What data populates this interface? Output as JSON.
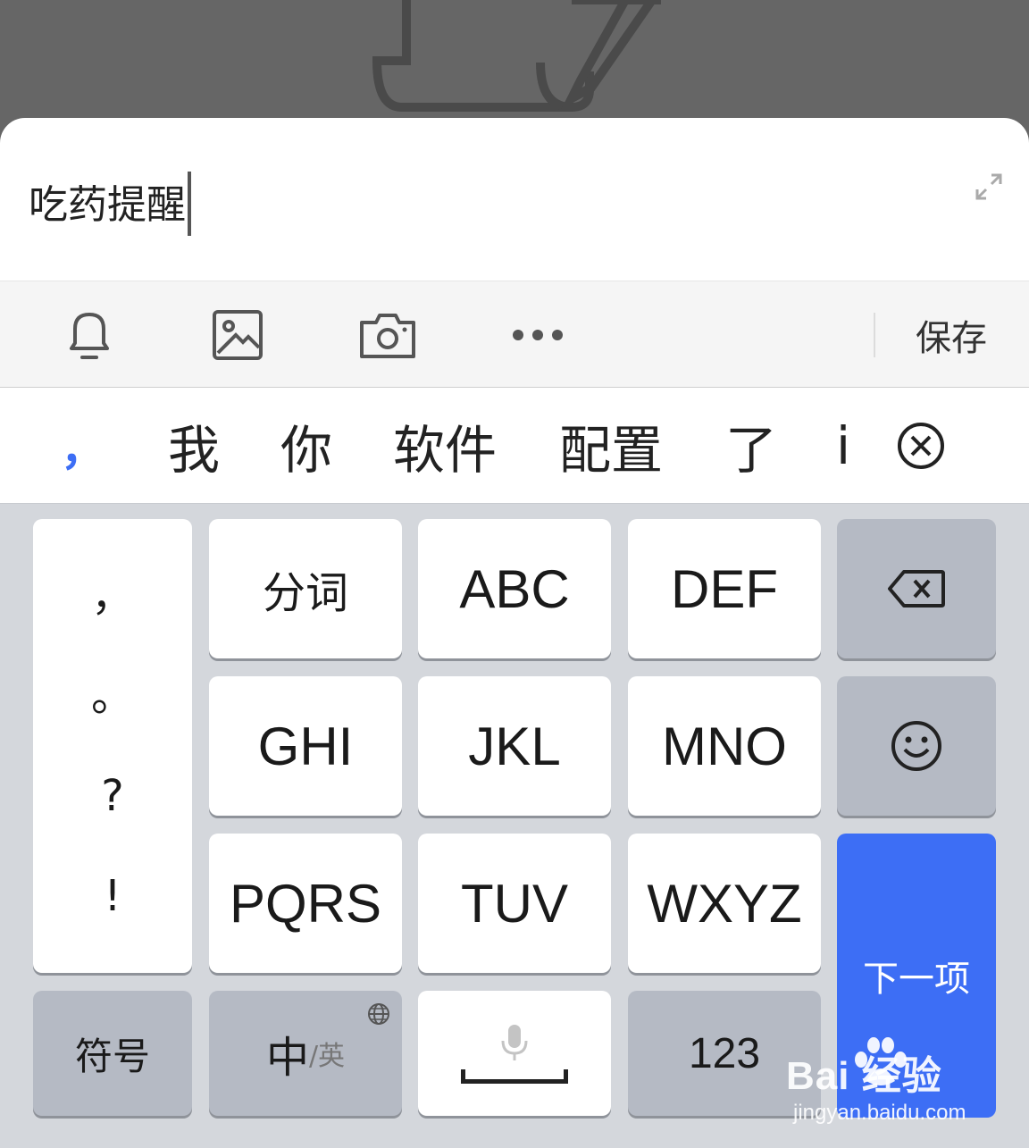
{
  "note": {
    "text": "吃药提醒"
  },
  "toolbar": {
    "save_label": "保存"
  },
  "candidates": [
    "，",
    "我",
    "你",
    "软件",
    "配置",
    "了",
    "i"
  ],
  "keyboard": {
    "punct": [
      "，",
      "。",
      "?",
      "!"
    ],
    "fenci": "分词",
    "abc": "ABC",
    "def": "DEF",
    "ghi": "GHI",
    "jkl": "JKL",
    "mno": "MNO",
    "pqrs": "PQRS",
    "tuv": "TUV",
    "wxyz": "WXYZ",
    "next": "下一项",
    "symbols": "符号",
    "zh": "中",
    "en": "/英",
    "num": "123"
  },
  "watermark": {
    "brand": "Bai 经验",
    "url": "jingyan.baidu.com"
  },
  "colors": {
    "accent": "#3d6ef5",
    "key_gray": "#b5bac4",
    "keyboard_bg": "#d4d7dc"
  }
}
